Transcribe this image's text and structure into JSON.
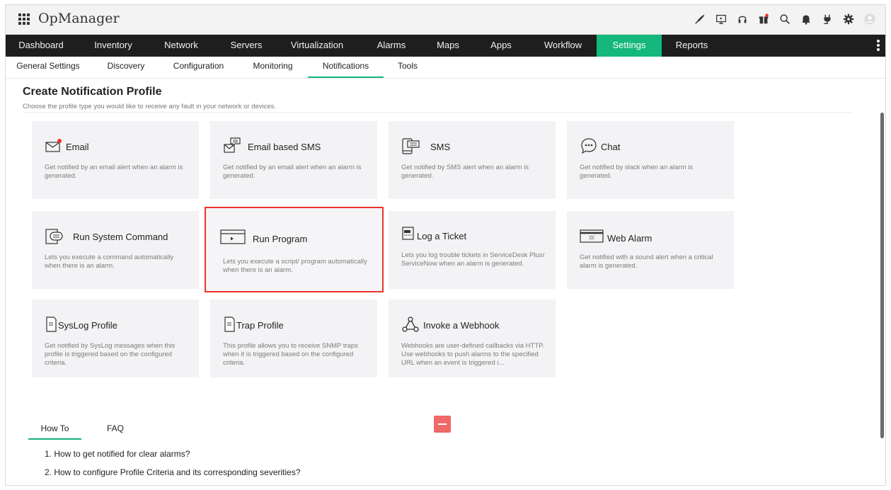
{
  "app": {
    "title": "OpManager"
  },
  "top_icons": [
    "rocket-icon",
    "presentation-icon",
    "headset-icon",
    "gift-icon",
    "search-icon",
    "bell-icon",
    "plug-icon",
    "gear-icon",
    "user-icon"
  ],
  "main_nav": [
    {
      "label": "Dashboard"
    },
    {
      "label": "Inventory"
    },
    {
      "label": "Network"
    },
    {
      "label": "Servers"
    },
    {
      "label": "Virtualization"
    },
    {
      "label": "Alarms"
    },
    {
      "label": "Maps"
    },
    {
      "label": "Apps"
    },
    {
      "label": "Workflow"
    },
    {
      "label": "Settings",
      "active": true
    },
    {
      "label": "Reports"
    }
  ],
  "sub_nav": [
    {
      "label": "General Settings"
    },
    {
      "label": "Discovery"
    },
    {
      "label": "Configuration"
    },
    {
      "label": "Monitoring"
    },
    {
      "label": "Notifications",
      "active": true
    },
    {
      "label": "Tools"
    }
  ],
  "page": {
    "title": "Create Notification Profile",
    "subtitle": "Choose the profile type you would like to receive any fault in your network or devices."
  },
  "cards": [
    {
      "title": "Email",
      "icon": "envelope-icon",
      "desc": "Get notified by an email alert when an alarm is generated."
    },
    {
      "title": "Email based SMS",
      "icon": "email-sms-icon",
      "desc": "Get notified by an email alert when an alarm is generated."
    },
    {
      "title": "SMS",
      "icon": "mobile-sms-icon",
      "desc": "Get notified by SMS alert when an alarm is generated."
    },
    {
      "title": "Chat",
      "icon": "chat-icon",
      "desc": "Get notified by slack when an alarm is generated."
    },
    {
      "title": "Run System Command",
      "icon": "terminal-icon",
      "desc": "Lets you execute a command automatically when there is an alarm."
    },
    {
      "title": "Run Program",
      "icon": "program-window-icon",
      "desc": "Lets you execute a script/ program automatically when there is an alarm.",
      "highlight": true
    },
    {
      "title": "Log a Ticket",
      "icon": "ticket-icon",
      "desc": "Lets you log trouble tickets in ServiceDesk Plus/ ServiceNow when an alarm is generated."
    },
    {
      "title": "Web Alarm",
      "icon": "web-alarm-icon",
      "desc": "Get notified with a sound alert when a critical alarm is generated."
    },
    {
      "title": "SysLog Profile",
      "icon": "document-icon",
      "desc": "Get notified by SysLog messages when this profile is triggered based on the configured criteria."
    },
    {
      "title": "Trap Profile",
      "icon": "document-icon",
      "desc": "This profile allows you to receive SNMP traps when it is triggered based on the configured criteria."
    },
    {
      "title": "Invoke a Webhook",
      "icon": "webhook-icon",
      "desc": "Webhooks are user-defined callbacks via HTTP. Use webhooks to push alarms to the specified URL when an event is triggered i..."
    }
  ],
  "help": {
    "tabs": [
      {
        "label": "How To",
        "active": true
      },
      {
        "label": "FAQ"
      }
    ],
    "items": [
      "1. How to get notified for clear alarms?",
      "2. How to configure Profile Criteria and its corresponding severities?"
    ]
  },
  "colors": {
    "accent": "#14b77c",
    "nav_bg": "#1e1e1e",
    "highlight": "#e8342a",
    "collapse": "#f06868"
  }
}
